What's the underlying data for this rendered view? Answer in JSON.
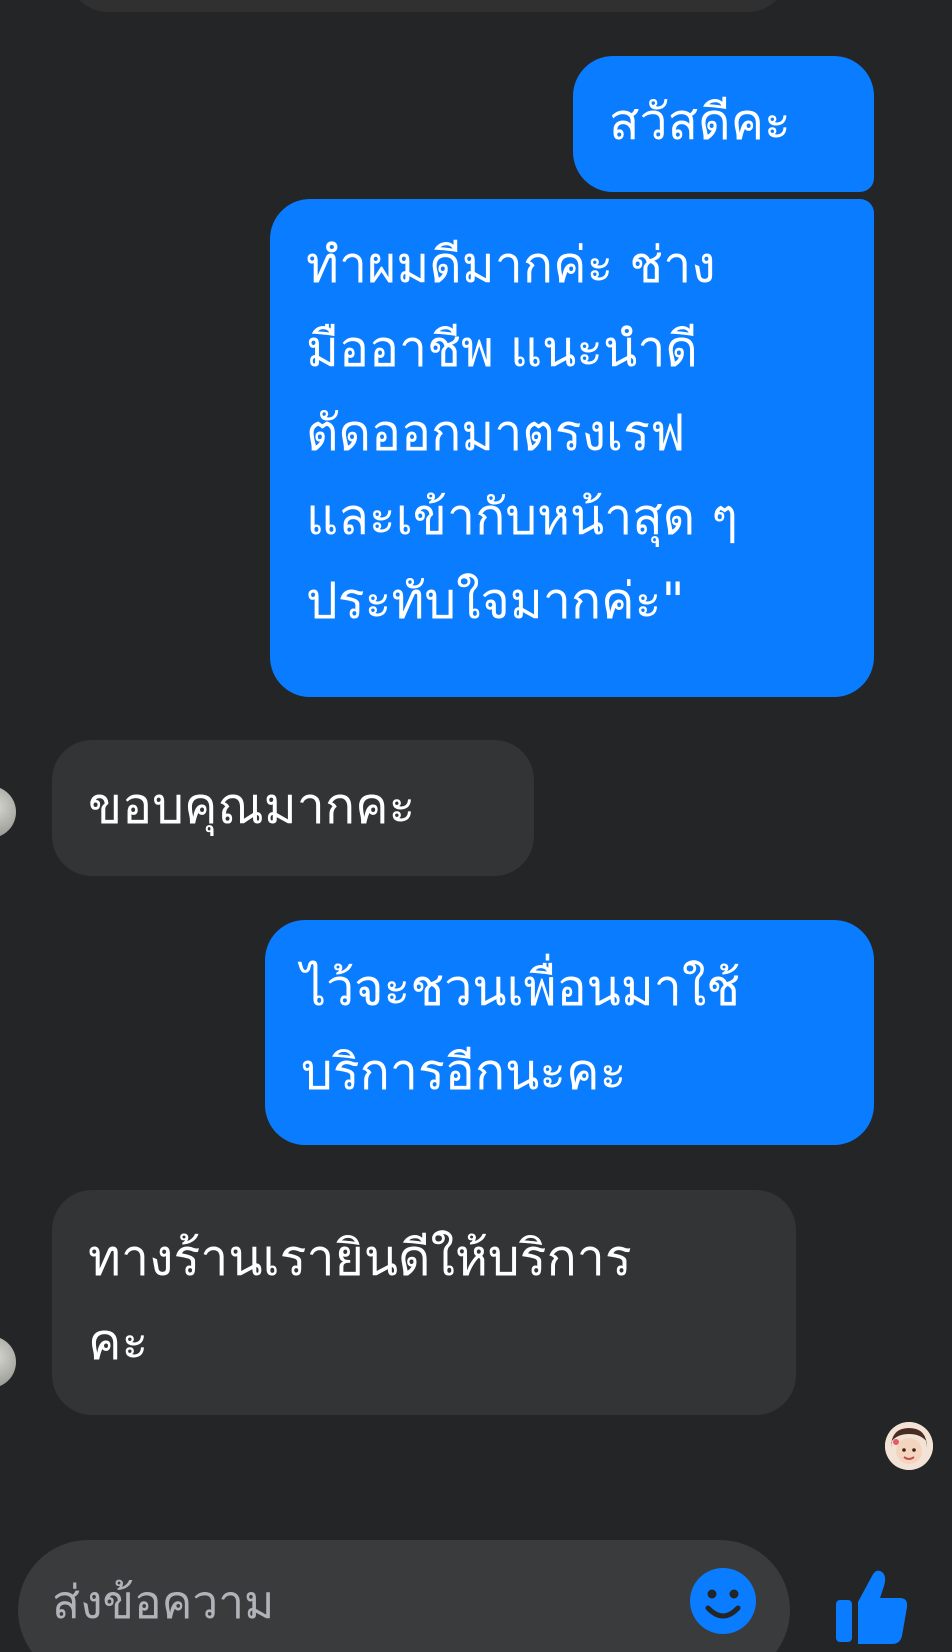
{
  "conversation": {
    "messages": [
      {
        "direction": "outgoing",
        "text": "สวัสดีคะ"
      },
      {
        "direction": "outgoing",
        "text": "ทำผมดีมากค่ะ ช่าง\nมืออาชีพ แนะนำดี\nตัดออกมาตรงเรฟ\nและเข้ากับหน้าสุด ๆ\nประทับใจมากค่ะ\""
      },
      {
        "direction": "incoming",
        "text": "ขอบคุณมากคะ"
      },
      {
        "direction": "outgoing",
        "text": "ไว้จะชวนเพื่อนมาใช้\nบริการอีกนะคะ"
      },
      {
        "direction": "incoming",
        "text": "ทางร้านเรายินดีให้บริการ\nคะ"
      }
    ]
  },
  "composer": {
    "placeholder": "ส่งข้อความ"
  },
  "icons": {
    "emoji": "smiley-face-icon",
    "send": "thumbs-up-icon"
  },
  "colors": {
    "background": "#242526",
    "outgoing_bubble": "#0a7cff",
    "incoming_bubble": "#333436",
    "accent": "#0a7cff"
  }
}
